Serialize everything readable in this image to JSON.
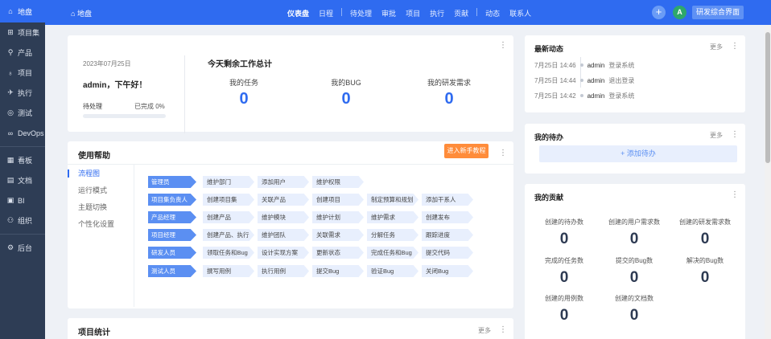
{
  "sidebar": {
    "items": [
      {
        "icon": "home-icon",
        "glyph": "⌂",
        "label": "地盘"
      },
      {
        "icon": "grid-icon",
        "glyph": "⊞",
        "label": "项目集"
      },
      {
        "icon": "location-icon",
        "glyph": "⚲",
        "label": "产品"
      },
      {
        "icon": "rocket-icon",
        "glyph": "♁",
        "label": "项目"
      },
      {
        "icon": "run-icon",
        "glyph": "✈",
        "label": "执行"
      },
      {
        "icon": "magnify-icon",
        "glyph": "◎",
        "label": "测试"
      },
      {
        "icon": "infinity-icon",
        "glyph": "∞",
        "label": "DevOps"
      },
      {
        "icon": "board-icon",
        "glyph": "▦",
        "label": "看板"
      },
      {
        "icon": "document-icon",
        "glyph": "▤",
        "label": "文档"
      },
      {
        "icon": "bi-icon",
        "glyph": "▣",
        "label": "BI"
      },
      {
        "icon": "people-icon",
        "glyph": "⚇",
        "label": "组织"
      },
      {
        "icon": "gear-icon",
        "glyph": "⚙",
        "label": "后台"
      }
    ]
  },
  "header": {
    "home_label": "地盘",
    "nav": [
      "仪表盘",
      "日程",
      "待处理",
      "审批",
      "项目",
      "执行",
      "贡献",
      "动态",
      "联系人"
    ],
    "add_glyph": "+",
    "avatar_letter": "A",
    "switch_label": "研发综合界面",
    "accent": "#2f6bf0"
  },
  "overview": {
    "date": "2023年07月25日",
    "greeting": "admin，下午好！",
    "todo_label": "待处理",
    "done_text": "已完成 0%",
    "progress": 0,
    "title": "今天剩余工作总计",
    "stats": [
      {
        "label": "我的任务",
        "value": "0"
      },
      {
        "label": "我的BUG",
        "value": "0"
      },
      {
        "label": "我的研发需求",
        "value": "0"
      }
    ]
  },
  "help": {
    "title": "使用帮助",
    "tutorial_btn": "进入新手教程",
    "menu": [
      "流程图",
      "运行模式",
      "主题切换",
      "个性化设置"
    ],
    "flows": [
      {
        "role": "管理员",
        "steps": [
          "维护部门",
          "添加用户",
          "维护权限"
        ]
      },
      {
        "role": "项目集负责人",
        "steps": [
          "创建项目集",
          "关联产品",
          "创建项目",
          "制定预算和规划",
          "添加干系人"
        ]
      },
      {
        "role": "产品经理",
        "steps": [
          "创建产品",
          "维护模块",
          "维护计划",
          "维护需求",
          "创建发布"
        ]
      },
      {
        "role": "项目经理",
        "steps": [
          "创建产品、执行",
          "维护团队",
          "关联需求",
          "分解任务",
          "跟踪进度"
        ]
      },
      {
        "role": "研发人员",
        "steps": [
          "领取任务和Bug",
          "设计实现方案",
          "更新状态",
          "完成任务和Bug",
          "提交代码"
        ]
      },
      {
        "role": "测试人员",
        "steps": [
          "撰写用例",
          "执行用例",
          "提交Bug",
          "验证Bug",
          "关闭Bug"
        ]
      }
    ]
  },
  "project_stats": {
    "title": "项目统计",
    "more": "更多"
  },
  "dynamics": {
    "title": "最新动态",
    "more": "更多",
    "items": [
      {
        "time": "7月25日 14:46",
        "user": "admin",
        "action": "登录系统"
      },
      {
        "time": "7月25日 14:44",
        "user": "admin",
        "action": "退出登录"
      },
      {
        "time": "7月25日 14:42",
        "user": "admin",
        "action": "登录系统"
      }
    ]
  },
  "todos": {
    "title": "我的待办",
    "more": "更多",
    "add_label": "+ 添加待办"
  },
  "contribution": {
    "title": "我的贡献",
    "items": [
      {
        "label": "创建的待办数",
        "value": "0"
      },
      {
        "label": "创建的用户需求数",
        "value": "0"
      },
      {
        "label": "创建的研发需求数",
        "value": "0"
      },
      {
        "label": "完成的任务数",
        "value": "0"
      },
      {
        "label": "提交的Bug数",
        "value": "0"
      },
      {
        "label": "解决的Bug数",
        "value": "0"
      },
      {
        "label": "创建的用例数",
        "value": "0"
      },
      {
        "label": "创建的文档数",
        "value": "0"
      }
    ]
  },
  "dots_glyph": "⋮"
}
